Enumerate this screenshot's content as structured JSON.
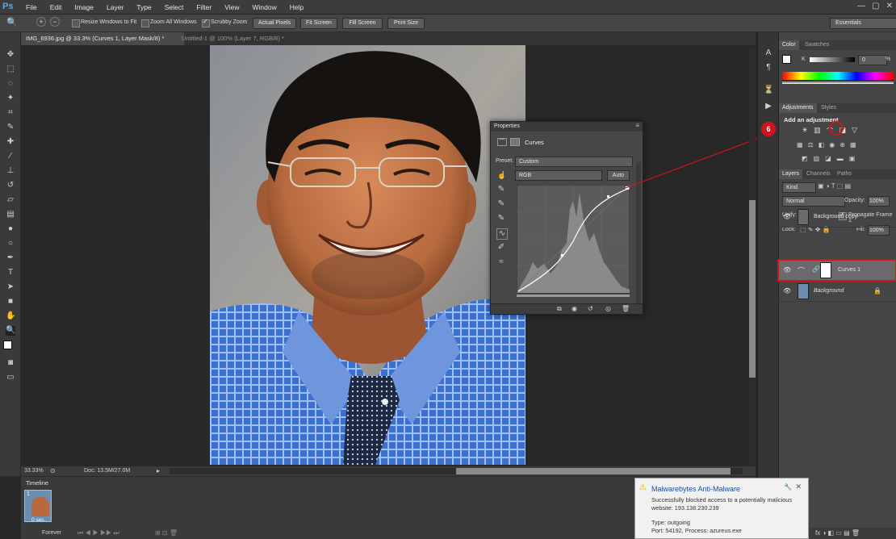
{
  "app": {
    "logo": "Ps",
    "window_controls": [
      "—",
      "▢",
      "✕"
    ]
  },
  "menu": [
    "File",
    "Edit",
    "Image",
    "Layer",
    "Type",
    "Select",
    "Filter",
    "View",
    "Window",
    "Help"
  ],
  "options": {
    "resize_windows": "Resize Windows to Fit",
    "zoom_all": "Zoom All Windows",
    "scrubby": "Scrubby Zoom",
    "actual_pixels": "Actual Pixels",
    "fit_screen": "Fit Screen",
    "fill_screen": "Fill Screen",
    "print_size": "Print Size",
    "workspace": "Essentials"
  },
  "tabs": [
    {
      "label": "IMG_6936.jpg @ 33.3% (Curves 1, Layer Mask/8) *"
    },
    {
      "label": "Untitled-1 @ 100% (Layer 7, RGB/8) *"
    }
  ],
  "status": {
    "zoom": "33.33%",
    "doc": "Doc: 13.5M/27.0M"
  },
  "timeline": {
    "title": "Timeline",
    "frame_number": "1",
    "frame_delay": "0 sec.",
    "loop": "Forever"
  },
  "color_panel": {
    "tabs": [
      "Color",
      "Swatches"
    ],
    "channel": "K",
    "value": "0",
    "unit": "%"
  },
  "adjustments": {
    "tabs": [
      "Adjustments",
      "Styles"
    ],
    "heading": "Add an adjustment",
    "callout_number": "6"
  },
  "layers_panel": {
    "tabs": [
      "Layers",
      "Channels",
      "Paths"
    ],
    "filter": "Kind",
    "blend": "Normal",
    "opacity_label": "Opacity:",
    "opacity_value": "100%",
    "unify_label": "Unify:",
    "propagate_label": "Propagate Frame 1",
    "lock_label": "Lock:",
    "fill_label": "Fill:",
    "fill_value": "100%",
    "layers": [
      {
        "name": "Background copy"
      },
      {
        "name": "Curves 1"
      },
      {
        "name": "Background"
      }
    ]
  },
  "properties": {
    "title": "Properties",
    "section": "Curves",
    "preset_label": "Preset:",
    "preset_value": "Custom",
    "channel_value": "RGB",
    "auto_label": "Auto"
  },
  "notification": {
    "title": "Malwarebytes Anti-Malware",
    "line1": "Successfully blocked access to a potentially malicious",
    "line2": "website: 193.138.230.239",
    "line3": "Type: outgoing",
    "line4": "Port: 54192, Process: azureus.exe"
  },
  "colors": {
    "highlight_red": "#d0141a",
    "accent_blue": "#5ea8e0"
  }
}
